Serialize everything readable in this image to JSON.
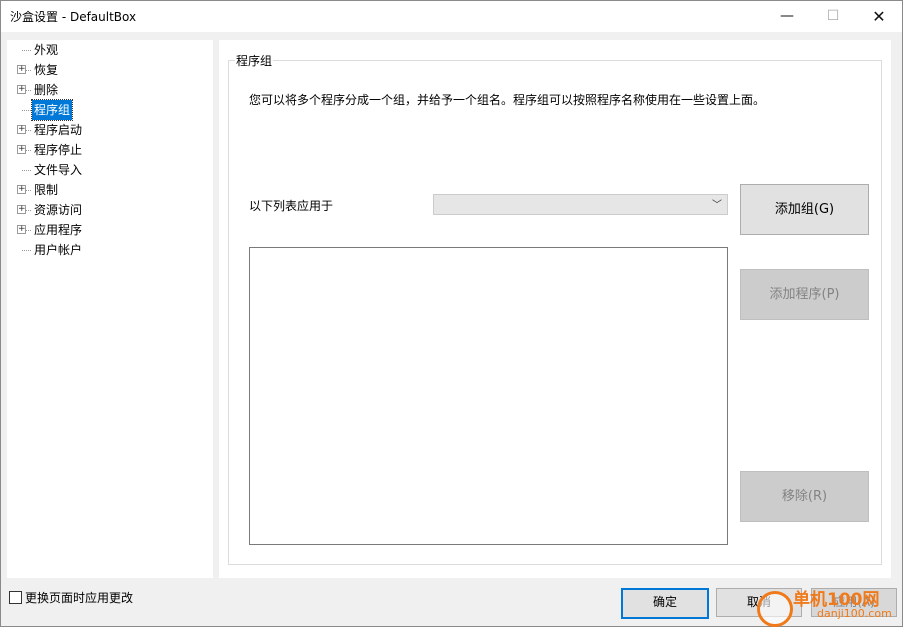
{
  "window": {
    "title": "沙盒设置 - DefaultBox",
    "minimize_glyph": "—",
    "maximize_glyph": "☐",
    "close_glyph": "✕"
  },
  "tree": {
    "items": [
      {
        "label": "外观",
        "expandable": false,
        "selected": false
      },
      {
        "label": "恢复",
        "expandable": true,
        "selected": false
      },
      {
        "label": "删除",
        "expandable": true,
        "selected": false
      },
      {
        "label": "程序组",
        "expandable": false,
        "selected": true
      },
      {
        "label": "程序启动",
        "expandable": true,
        "selected": false
      },
      {
        "label": "程序停止",
        "expandable": true,
        "selected": false
      },
      {
        "label": "文件导入",
        "expandable": false,
        "selected": false
      },
      {
        "label": "限制",
        "expandable": true,
        "selected": false
      },
      {
        "label": "资源访问",
        "expandable": true,
        "selected": false
      },
      {
        "label": "应用程序",
        "expandable": true,
        "selected": false
      },
      {
        "label": "用户帐户",
        "expandable": false,
        "selected": false
      }
    ]
  },
  "panel": {
    "group_title": "程序组",
    "description": "您可以将多个程序分成一个组，并给予一个组名。程序组可以按照程序名称使用在一些设置上面。",
    "apply_to_label": "以下列表应用于",
    "combo_value": "",
    "buttons": {
      "add_group": "添加组(G)",
      "add_program": "添加程序(P)",
      "remove": "移除(R)"
    }
  },
  "footer": {
    "checkbox_label": "更换页面时应用更改",
    "checkbox_checked": false,
    "ok": "确定",
    "cancel": "取消",
    "apply": "应用(A)"
  },
  "watermark": {
    "line1": "单机100网",
    "line2": "danji100.com"
  },
  "colors": {
    "selection": "#0078d7",
    "watermark": "#f07a1a"
  }
}
